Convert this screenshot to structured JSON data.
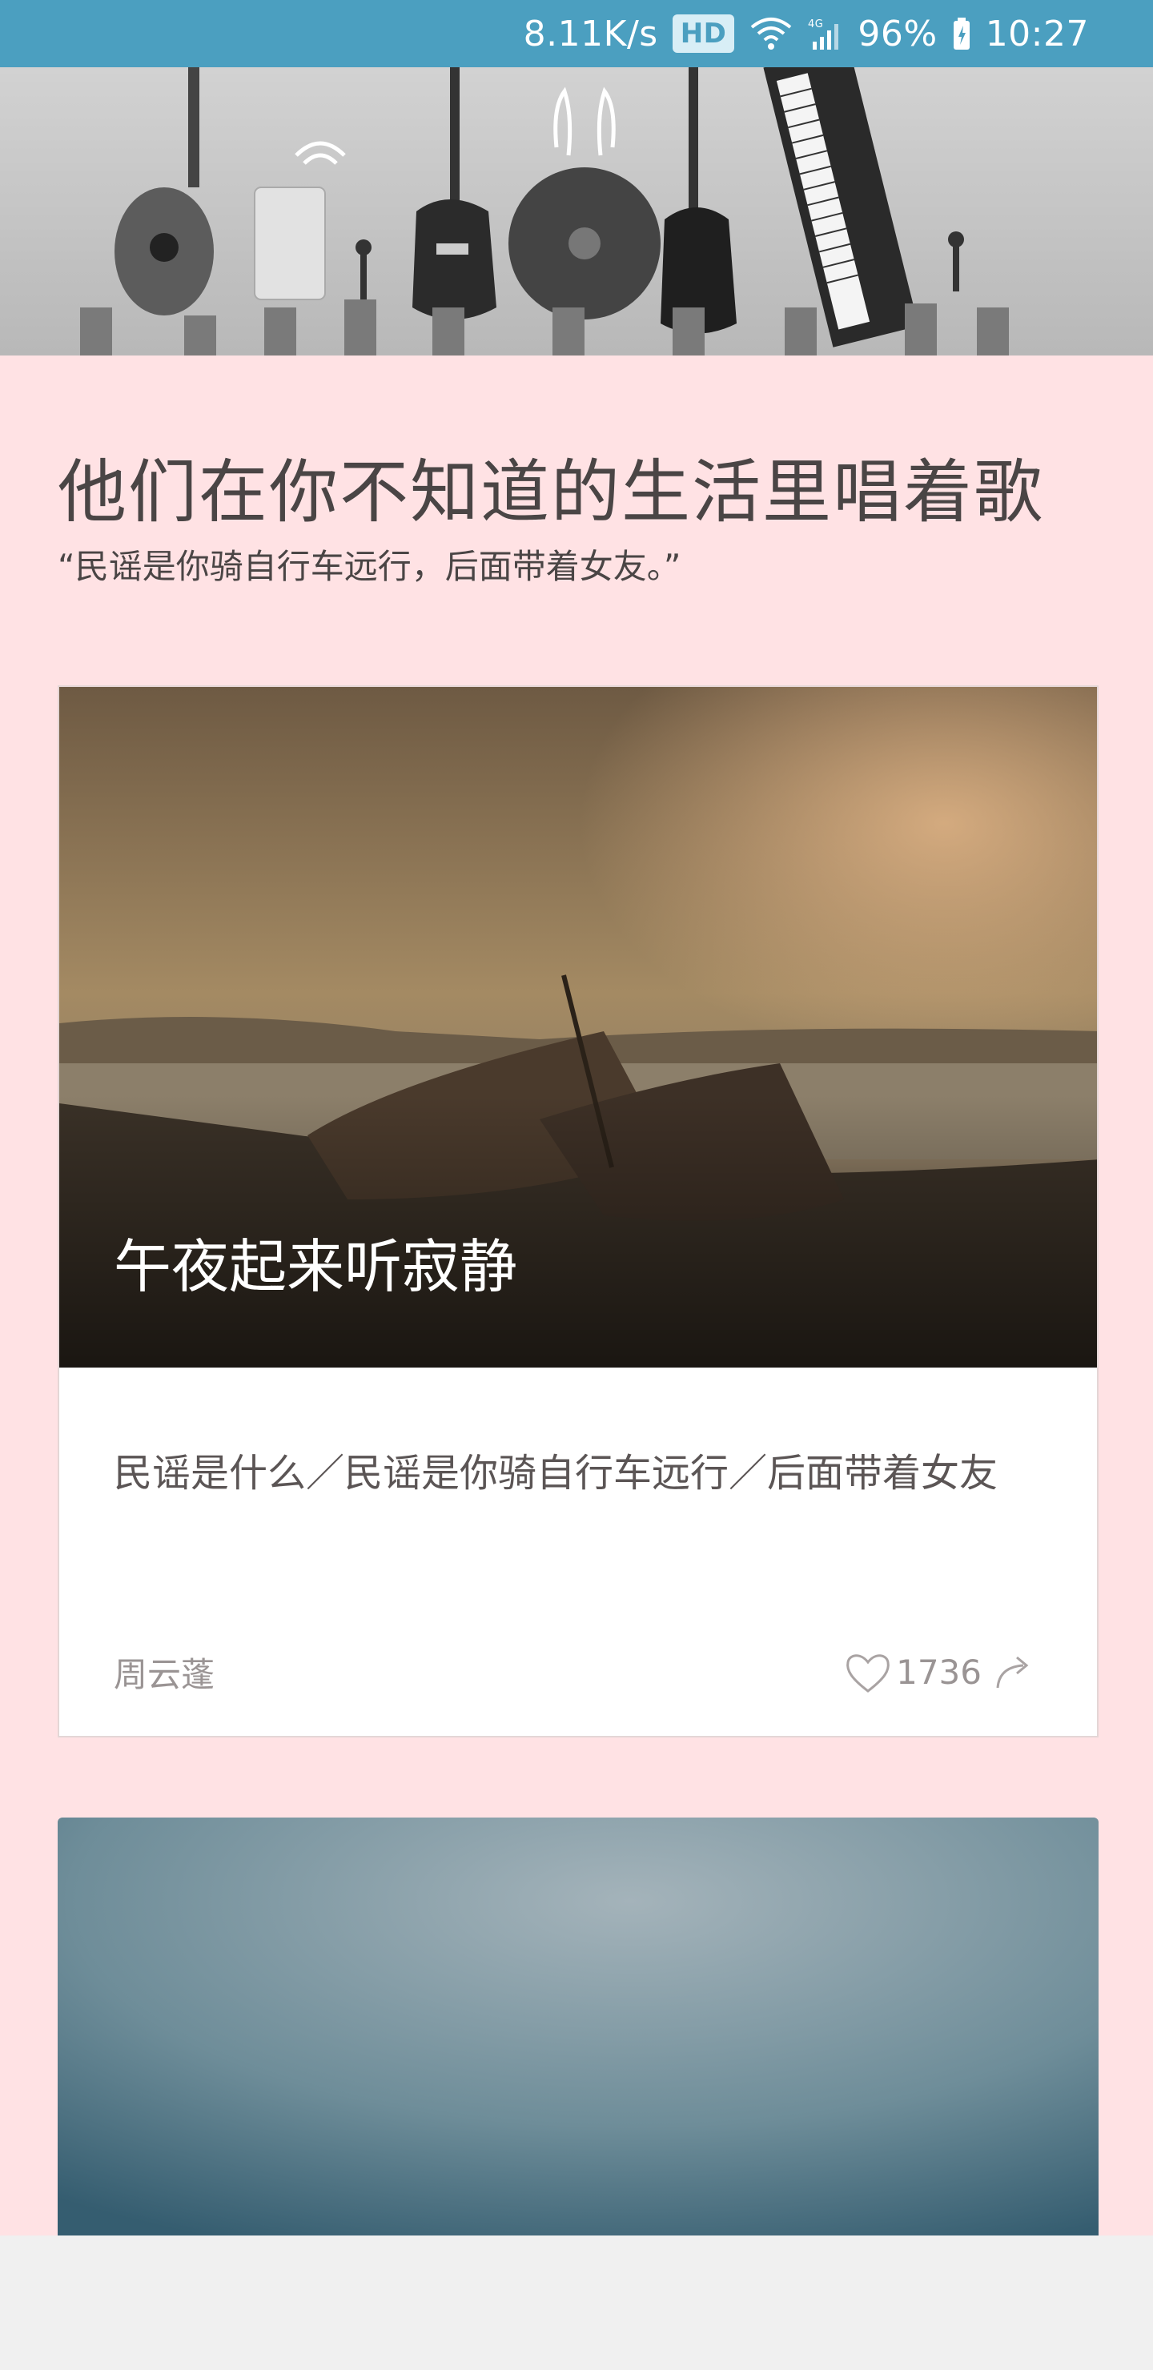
{
  "status_bar": {
    "net_speed": "8.11K/s",
    "hd": "HD",
    "network": "4G",
    "battery": "96%",
    "time": "10:27"
  },
  "header": {
    "title": "他们在你不知道的生活里唱着歌",
    "subtitle": "“民谣是你骑自行车远行，后面带着女友。”"
  },
  "cards": [
    {
      "title": "午夜起来听寂静",
      "body": "民谣是什么／民谣是你骑自行车远行／后面带着女友",
      "author": "周云蓬",
      "likes": "1736",
      "like_icon": "heart-icon",
      "share_icon": "share-icon"
    }
  ],
  "colors": {
    "status_bar": "#4b9fc0",
    "page_background": "#ffe2e4",
    "card_background": "#ffffff"
  }
}
